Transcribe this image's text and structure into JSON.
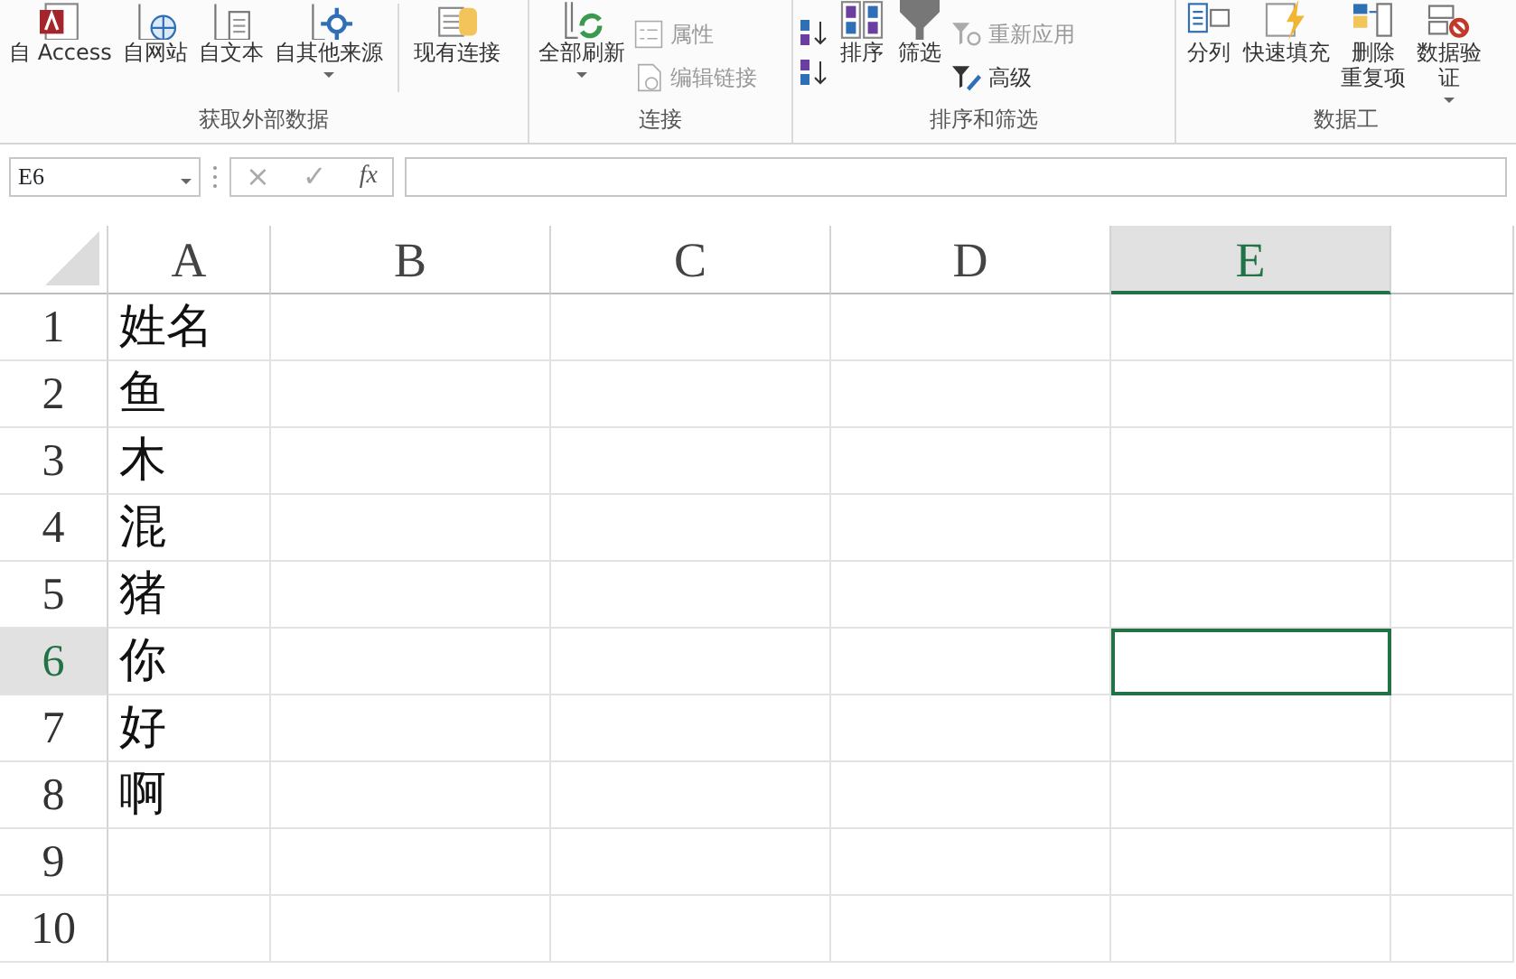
{
  "ribbon": {
    "groups": [
      {
        "label": "获取外部数据",
        "items": [
          {
            "kind": "large",
            "lines": [
              "自 Access"
            ],
            "caret": false
          },
          {
            "kind": "large",
            "lines": [
              "自网站"
            ],
            "caret": false
          },
          {
            "kind": "large",
            "lines": [
              "自文本"
            ],
            "caret": false
          },
          {
            "kind": "large",
            "lines": [
              "自其他来源"
            ],
            "caret": true
          },
          {
            "kind": "sep"
          },
          {
            "kind": "large",
            "lines": [
              "现有连接"
            ],
            "caret": false
          }
        ]
      },
      {
        "label": "连接",
        "items": [
          {
            "kind": "large",
            "lines": [
              "全部刷新"
            ],
            "caret": true
          },
          {
            "kind": "stack",
            "entries": [
              {
                "label": "属性",
                "disabled": true
              },
              {
                "label": "编辑链接",
                "disabled": true
              }
            ]
          }
        ]
      },
      {
        "label": "排序和筛选",
        "items": [
          {
            "kind": "sorticons"
          },
          {
            "kind": "large",
            "lines": [
              "排序"
            ],
            "caret": false
          },
          {
            "kind": "large",
            "lines": [
              "筛选"
            ],
            "caret": false
          },
          {
            "kind": "stack",
            "entries": [
              {
                "label": "重新应用",
                "disabled": true
              },
              {
                "label": "高级",
                "disabled": false
              }
            ]
          }
        ]
      },
      {
        "label": "数据工",
        "items": [
          {
            "kind": "large",
            "lines": [
              "分列"
            ],
            "caret": false
          },
          {
            "kind": "large",
            "lines": [
              "快速填充"
            ],
            "caret": false
          },
          {
            "kind": "large",
            "lines": [
              "删除",
              "重复项"
            ],
            "caret": false
          },
          {
            "kind": "large",
            "lines": [
              "数据验",
              "证"
            ],
            "caret": true
          }
        ]
      }
    ]
  },
  "name_box": "E6",
  "formula_buttons": [
    "×",
    "✓",
    "fx"
  ],
  "columns": [
    {
      "label": "A",
      "selected": false
    },
    {
      "label": "B",
      "selected": false
    },
    {
      "label": "C",
      "selected": false
    },
    {
      "label": "D",
      "selected": false
    },
    {
      "label": "E",
      "selected": true
    }
  ],
  "rows": [
    {
      "label": "1",
      "selected": false,
      "cells": [
        "姓名"
      ]
    },
    {
      "label": "2",
      "selected": false,
      "cells": [
        "鱼"
      ]
    },
    {
      "label": "3",
      "selected": false,
      "cells": [
        "木"
      ]
    },
    {
      "label": "4",
      "selected": false,
      "cells": [
        "混"
      ]
    },
    {
      "label": "5",
      "selected": false,
      "cells": [
        "猪"
      ]
    },
    {
      "label": "6",
      "selected": true,
      "cells": [
        "你"
      ]
    },
    {
      "label": "7",
      "selected": false,
      "cells": [
        "好"
      ]
    },
    {
      "label": "8",
      "selected": false,
      "cells": [
        "啊"
      ]
    },
    {
      "label": "9",
      "selected": false
    },
    {
      "label": "10",
      "selected": false
    }
  ]
}
